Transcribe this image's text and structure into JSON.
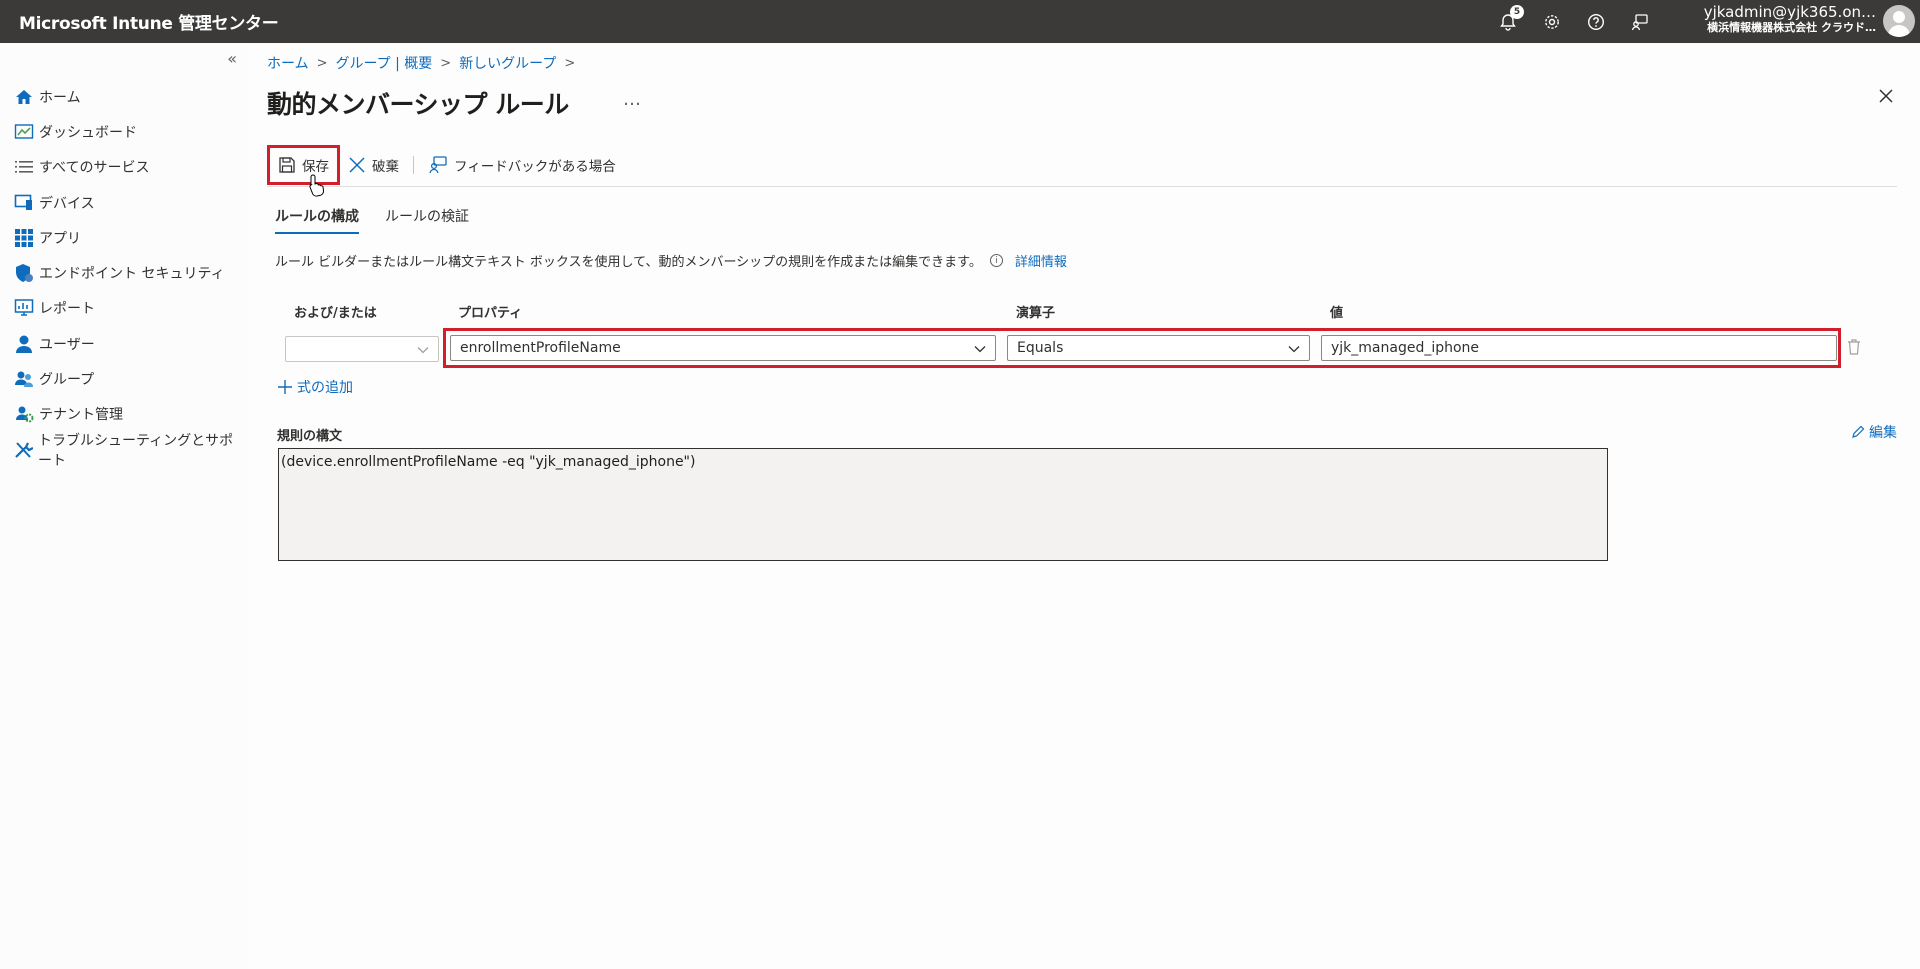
{
  "app": {
    "title": "Microsoft Intune 管理センター"
  },
  "topbar": {
    "notification_count": "5",
    "account_email": "yjkadmin@yjk365.on…",
    "account_org": "横浜情報機器株式会社 クラウド…"
  },
  "sidebar": {
    "items": [
      {
        "label": "ホーム",
        "icon": "home-icon"
      },
      {
        "label": "ダッシュボード",
        "icon": "dashboard-icon"
      },
      {
        "label": "すべてのサービス",
        "icon": "list-icon"
      },
      {
        "label": "デバイス",
        "icon": "device-icon"
      },
      {
        "label": "アプリ",
        "icon": "apps-icon"
      },
      {
        "label": "エンドポイント セキュリティ",
        "icon": "shield-icon"
      },
      {
        "label": "レポート",
        "icon": "report-icon"
      },
      {
        "label": "ユーザー",
        "icon": "user-icon"
      },
      {
        "label": "グループ",
        "icon": "group-icon"
      },
      {
        "label": "テナント管理",
        "icon": "tenant-icon"
      },
      {
        "label": "トラブルシューティングとサポート",
        "icon": "wrench-icon"
      }
    ]
  },
  "breadcrumb": {
    "items": [
      "ホーム",
      "グループ | 概要",
      "新しいグループ"
    ]
  },
  "page": {
    "title": "動的メンバーシップ ルール",
    "more": "…"
  },
  "toolbar": {
    "save": "保存",
    "discard": "破棄",
    "feedback": "フィードバックがある場合"
  },
  "tabs": {
    "configure": "ルールの構成",
    "validate": "ルールの検証"
  },
  "description": {
    "text": "ルール ビルダーまたはルール構文テキスト ボックスを使用して、動的メンバーシップの規則を作成または編集できます。",
    "link": "詳細情報"
  },
  "rule_table": {
    "headers": {
      "andor": "および/または",
      "property": "プロパティ",
      "operator": "演算子",
      "value": "値"
    },
    "row": {
      "andor": "",
      "property": "enrollmentProfileName",
      "operator": "Equals",
      "value": "yjk_managed_iphone"
    }
  },
  "add_expression": "式の追加",
  "syntax": {
    "label": "規則の構文",
    "edit": "編集",
    "text": "(device.enrollmentProfileName -eq \"yjk_managed_iphone\")"
  },
  "colors": {
    "accent": "#0f6cbd",
    "highlight": "#d21f2c",
    "topbar": "#3b3a39"
  }
}
